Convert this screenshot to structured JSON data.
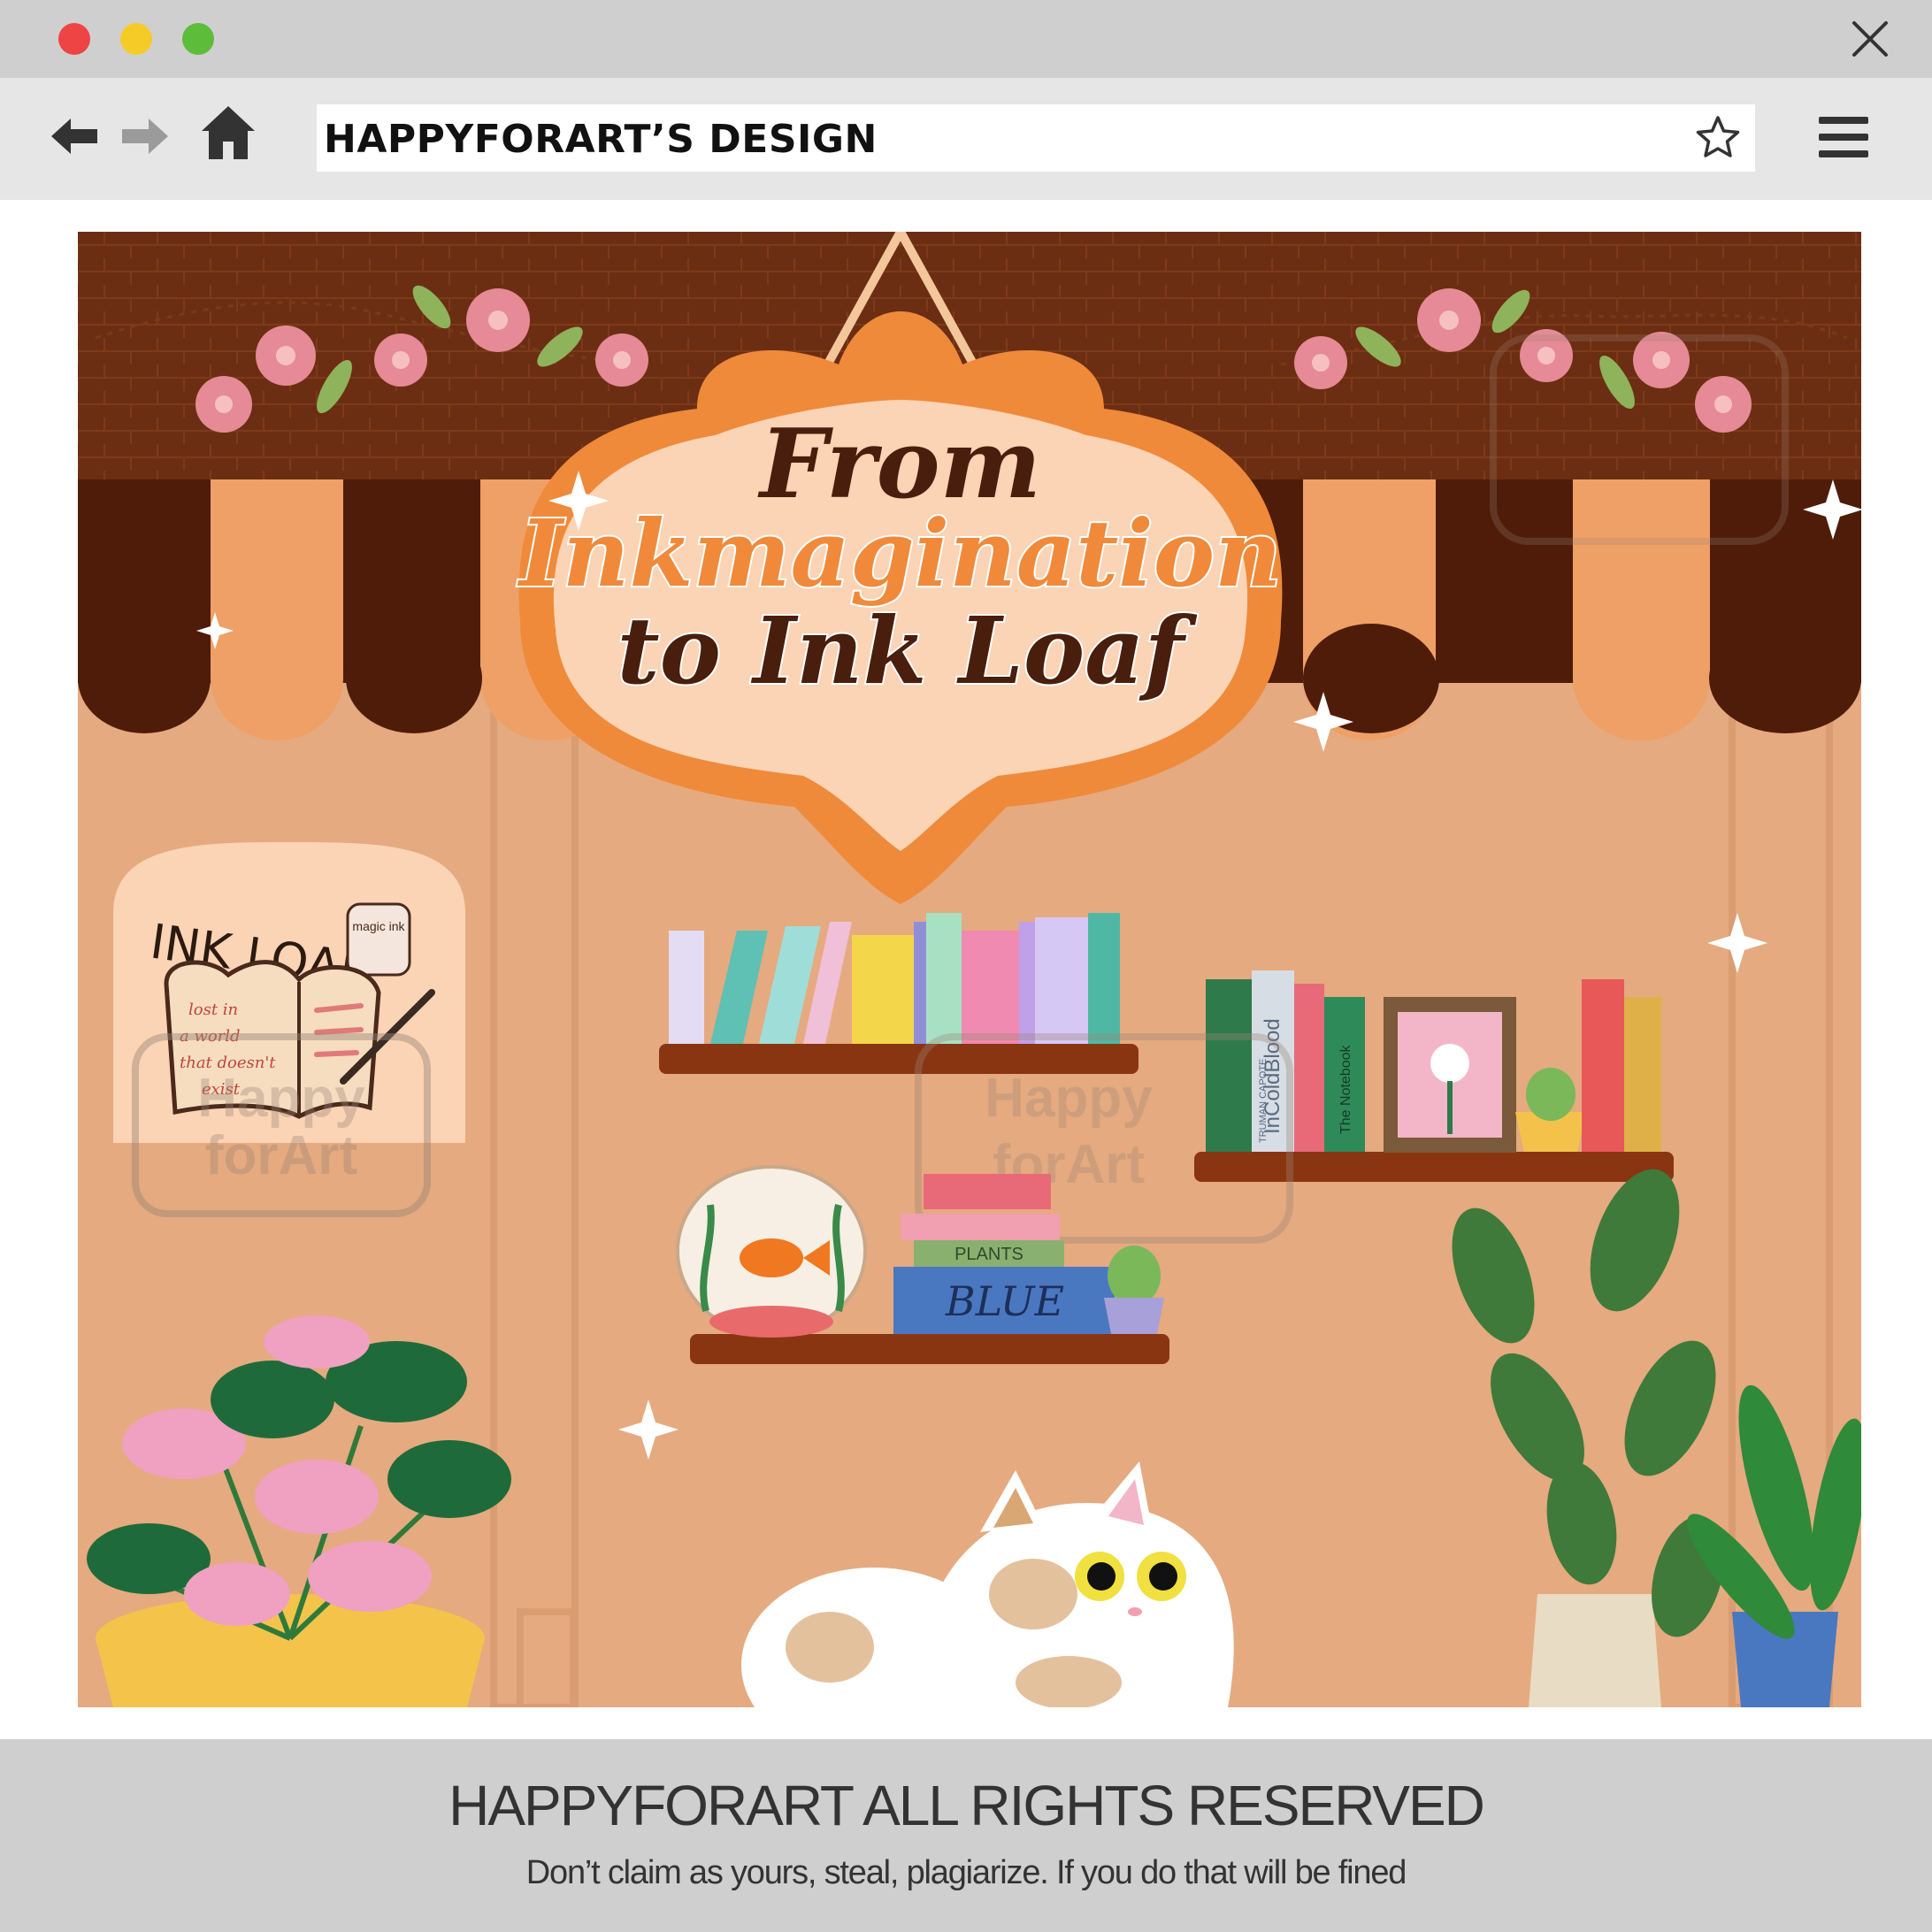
{
  "window": {
    "controls": [
      "close-dot",
      "minimize-dot",
      "maximize-dot"
    ],
    "colors": {
      "close": "#ee4444",
      "minimize": "#f5cc27",
      "maximize": "#5cbd3a"
    }
  },
  "toolbar": {
    "address_text": "HAPPYFORART’S DESIGN",
    "icons": [
      "back-arrow-icon",
      "forward-arrow-icon",
      "home-icon",
      "star-icon",
      "hamburger-menu-icon"
    ]
  },
  "artwork": {
    "sign": {
      "line1": "From",
      "line2": "Inkmagination",
      "line3": "to Ink Loaf"
    },
    "poster": {
      "title": "INK LOAF",
      "jar_label": "magic ink",
      "page_text": [
        "lost in",
        "a world",
        "that doesn't",
        "exist"
      ]
    },
    "book_spines": {
      "truman": "TRUMAN CAPOTE",
      "in_cold_blood": "InColdBlood",
      "notebook": "The Notebook"
    },
    "stack": {
      "plants": "PLANTS",
      "blue": "BLUE"
    },
    "watermark": [
      "Happy",
      "forArt"
    ],
    "colors": {
      "brick": "#6b2e12",
      "awning_dark": "#4f1c0a",
      "awning_light": "#efa066",
      "wall": "#e5aa7f",
      "sign_orange": "#ef8a3a",
      "shelf": "#8a3512"
    }
  },
  "footer": {
    "title": "HAPPYFORART ALL RIGHTS RESERVED",
    "subtitle": "Don’t claim as yours, steal, plagiarize. If you do that will be fined"
  }
}
